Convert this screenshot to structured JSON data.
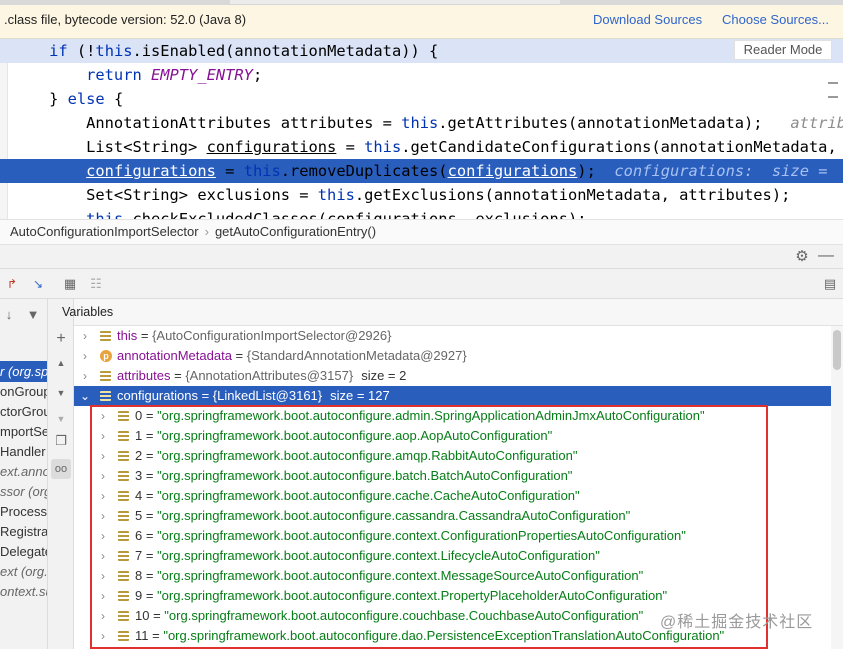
{
  "top_bar": {
    "notice": ".class file, bytecode version: 52.0 (Java 8)",
    "download_sources": "Download Sources",
    "choose_sources": "Choose Sources..."
  },
  "editor": {
    "reader_mode": "Reader Mode",
    "lines": [
      {
        "segments": [
          {
            "t": "    if ",
            "c": "kw"
          },
          {
            "t": "(!",
            "c": "var"
          },
          {
            "t": "this",
            "c": "kw"
          },
          {
            "t": ".isEnabled(annotationMetadata)) {",
            "c": "var"
          }
        ]
      },
      {
        "segments": [
          {
            "t": "        return ",
            "c": "kw"
          },
          {
            "t": "EMPTY_ENTRY",
            "c": "cst"
          },
          {
            "t": ";",
            "c": "var"
          }
        ]
      },
      {
        "segments": [
          {
            "t": "    } ",
            "c": "var"
          },
          {
            "t": "else",
            "c": "kw"
          },
          {
            "t": " {",
            "c": "var"
          }
        ]
      },
      {
        "segments": [
          {
            "t": "        AnnotationAttributes attributes = ",
            "c": "var"
          },
          {
            "t": "this",
            "c": "kw"
          },
          {
            "t": ".getAttributes(annotationMetadata);   ",
            "c": "var"
          },
          {
            "t": "attrib",
            "c": "hint"
          }
        ]
      },
      {
        "segments": [
          {
            "t": "        List<String> ",
            "c": "var"
          },
          {
            "t": "configurations",
            "c": "und"
          },
          {
            "t": " = ",
            "c": "var"
          },
          {
            "t": "this",
            "c": "kw"
          },
          {
            "t": ".getCandidateConfigurations(annotationMetadata,",
            "c": "var"
          }
        ]
      },
      {
        "segments": [
          {
            "t": "        ",
            "c": "var"
          },
          {
            "t": "configurations",
            "c": "und"
          },
          {
            "t": " = ",
            "c": "var"
          },
          {
            "t": "this",
            "c": "kw"
          },
          {
            "t": ".removeDuplicates(",
            "c": "var"
          },
          {
            "t": "configurations",
            "c": "und"
          },
          {
            "t": ");  ",
            "c": "var"
          },
          {
            "t": "configurations:  size = ",
            "c": "hint"
          }
        ]
      },
      {
        "segments": [
          {
            "t": "        Set<String> exclusions = ",
            "c": "var"
          },
          {
            "t": "this",
            "c": "kw"
          },
          {
            "t": ".getExclusions(annotationMetadata, attributes);",
            "c": "var"
          }
        ]
      },
      {
        "segments": [
          {
            "t": "        ",
            "c": "var"
          },
          {
            "t": "this",
            "c": "kw"
          },
          {
            "t": ".checkExcludedClasses(configurations, exclusions);",
            "c": "var"
          }
        ]
      }
    ]
  },
  "breadcrumb": {
    "class_name": "AutoConfigurationImportSelector",
    "method_name": "getAutoConfigurationEntry()"
  },
  "panel": {
    "variables_label": "Variables"
  },
  "frames": [
    {
      "text": "r (org.sp",
      "style": "active"
    },
    {
      "text": "onGroup",
      "style": "normal"
    },
    {
      "text": "ctorGroup",
      "style": "normal"
    },
    {
      "text": "mportSel",
      "style": "normal"
    },
    {
      "text": "Handler",
      "style": "normal"
    },
    {
      "text": "ext.anno",
      "style": "it"
    },
    {
      "text": "ssor (org",
      "style": "it"
    },
    {
      "text": "Processo",
      "style": "normal"
    },
    {
      "text": "Registrat",
      "style": "normal"
    },
    {
      "text": "Delegate",
      "style": "normal"
    },
    {
      "text": "ext (org.s",
      "style": "it"
    },
    {
      "text": "ontext.su",
      "style": "it"
    }
  ],
  "variables": [
    {
      "indent": 0,
      "icon": "field",
      "name": "this",
      "value": "{AutoConfigurationImportSelector@2926}",
      "extra": ""
    },
    {
      "indent": 0,
      "icon": "param",
      "name": "annotationMetadata",
      "value": "{StandardAnnotationMetadata@2927}",
      "extra": ""
    },
    {
      "indent": 0,
      "icon": "field",
      "name": "attributes",
      "value": "{AnnotationAttributes@3157}",
      "extra": "size = 2"
    },
    {
      "indent": 0,
      "icon": "field",
      "name": "configurations",
      "value": "{LinkedList@3161}",
      "extra": "size = 127",
      "selected": true,
      "expanded": true
    },
    {
      "indent": 1,
      "icon": "field",
      "name": "0",
      "value": "\"org.springframework.boot.autoconfigure.admin.SpringApplicationAdminJmxAutoConfiguration\""
    },
    {
      "indent": 1,
      "icon": "field",
      "name": "1",
      "value": "\"org.springframework.boot.autoconfigure.aop.AopAutoConfiguration\""
    },
    {
      "indent": 1,
      "icon": "field",
      "name": "2",
      "value": "\"org.springframework.boot.autoconfigure.amqp.RabbitAutoConfiguration\""
    },
    {
      "indent": 1,
      "icon": "field",
      "name": "3",
      "value": "\"org.springframework.boot.autoconfigure.batch.BatchAutoConfiguration\""
    },
    {
      "indent": 1,
      "icon": "field",
      "name": "4",
      "value": "\"org.springframework.boot.autoconfigure.cache.CacheAutoConfiguration\""
    },
    {
      "indent": 1,
      "icon": "field",
      "name": "5",
      "value": "\"org.springframework.boot.autoconfigure.cassandra.CassandraAutoConfiguration\""
    },
    {
      "indent": 1,
      "icon": "field",
      "name": "6",
      "value": "\"org.springframework.boot.autoconfigure.context.ConfigurationPropertiesAutoConfiguration\""
    },
    {
      "indent": 1,
      "icon": "field",
      "name": "7",
      "value": "\"org.springframework.boot.autoconfigure.context.LifecycleAutoConfiguration\""
    },
    {
      "indent": 1,
      "icon": "field",
      "name": "8",
      "value": "\"org.springframework.boot.autoconfigure.context.MessageSourceAutoConfiguration\""
    },
    {
      "indent": 1,
      "icon": "field",
      "name": "9",
      "value": "\"org.springframework.boot.autoconfigure.context.PropertyPlaceholderAutoConfiguration\""
    },
    {
      "indent": 1,
      "icon": "field",
      "name": "10",
      "value": "\"org.springframework.boot.autoconfigure.couchbase.CouchbaseAutoConfiguration\""
    },
    {
      "indent": 1,
      "icon": "field",
      "name": "11",
      "value": "\"org.springframework.boot.autoconfigure.dao.PersistenceExceptionTranslationAutoConfiguration\""
    }
  ],
  "watermark": "@稀土掘金技术社区",
  "colors": {
    "accent": "#2a5ebd",
    "highlight_box": "#e03030",
    "link": "#2f65ca"
  },
  "icons": [
    "gear-icon",
    "minimize-icon",
    "layout-icon",
    "table-icon",
    "settings-icon",
    "down-arrow-icon",
    "filter-icon",
    "add-icon",
    "copy-icon",
    "glasses-icon",
    "up-icon",
    "down-icon"
  ]
}
